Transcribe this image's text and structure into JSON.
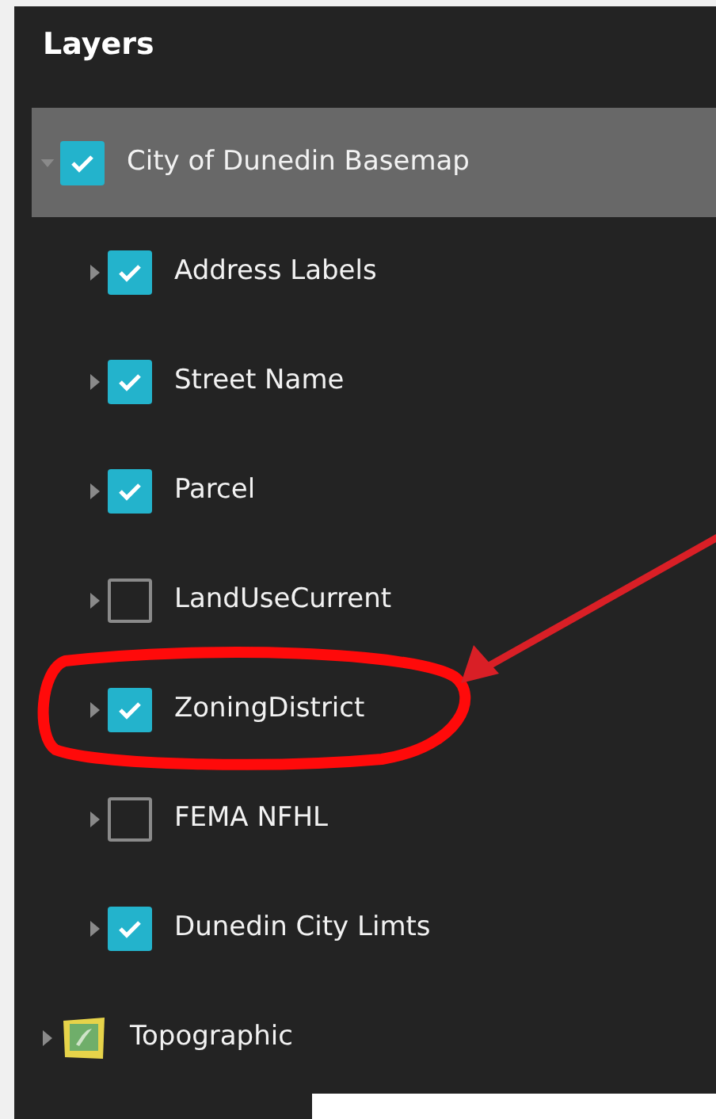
{
  "panel": {
    "title": "Layers"
  },
  "layers": [
    {
      "kind": "group",
      "label": "City of Dunedin Basemap",
      "expanded": true,
      "checked": true,
      "selected": true,
      "highlighted": false,
      "children": [
        {
          "kind": "layer",
          "label": "Address Labels",
          "expanded": false,
          "checked": true,
          "selected": false,
          "highlighted": false
        },
        {
          "kind": "layer",
          "label": "Street Name",
          "expanded": false,
          "checked": true,
          "selected": false,
          "highlighted": false
        },
        {
          "kind": "layer",
          "label": "Parcel",
          "expanded": false,
          "checked": true,
          "selected": false,
          "highlighted": false
        },
        {
          "kind": "layer",
          "label": "LandUseCurrent",
          "expanded": false,
          "checked": false,
          "selected": false,
          "highlighted": false
        },
        {
          "kind": "layer",
          "label": "ZoningDistrict",
          "expanded": false,
          "checked": true,
          "selected": false,
          "highlighted": true
        },
        {
          "kind": "layer",
          "label": "FEMA NFHL",
          "expanded": false,
          "checked": false,
          "selected": false,
          "highlighted": false
        },
        {
          "kind": "layer",
          "label": "Dunedin City Limts",
          "expanded": false,
          "checked": true,
          "selected": false,
          "highlighted": false
        }
      ]
    },
    {
      "kind": "basemap",
      "label": "Topographic",
      "expanded": false,
      "selected": false,
      "highlighted": false
    }
  ]
}
